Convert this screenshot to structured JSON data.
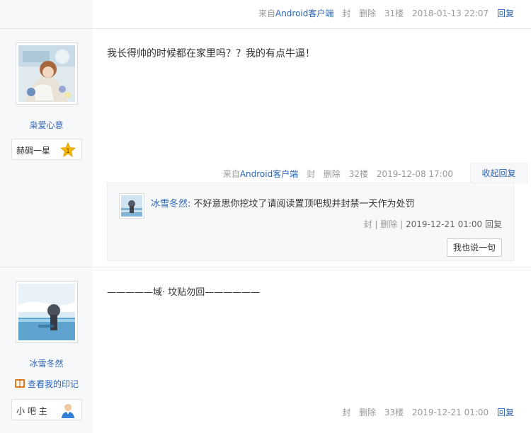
{
  "post_top": {
    "source_prefix": "来自",
    "source_client": "Android客户端",
    "ban": "封",
    "delete": "删除",
    "floor": "31楼",
    "time": "2018-01-13 22:07",
    "reply": "回复"
  },
  "post_1": {
    "username": "枭爱心意",
    "badge": {
      "text": "赫碉一星",
      "level": "1"
    },
    "text": "我长得帅的时候都在家里吗？？我的有点牛逼！",
    "meta": {
      "source_prefix": "来自",
      "source_client": "Android客户端",
      "ban": "封",
      "delete": "删除",
      "floor": "32楼",
      "time": "2019-12-08 17:00"
    },
    "collapse_reply": "收起回复",
    "sub_reply": {
      "user": "冰雪冬然:",
      "text": "不好意思你挖坟了请阅读置顶吧规并封禁一天作为处罚",
      "ban": "封",
      "sep": "|",
      "delete": "删除",
      "time": "2019-12-21 01:00",
      "reply": "回复"
    },
    "say_button": "我也说一句"
  },
  "post_2": {
    "username": "冰雪冬然",
    "mark_link": "查看我的印记",
    "badge": {
      "text": "小 吧 主"
    },
    "text": "—————域· 坟贴勿回——————",
    "meta": {
      "ban": "封",
      "delete": "删除",
      "floor": "33楼",
      "time": "2019-12-21 01:00",
      "reply": "回复"
    }
  },
  "colors": {
    "link": "#2d64b3",
    "sidebar_bg": "#f7f8fa",
    "meta_gray": "#999999",
    "star_gold": "#f5b800"
  },
  "icons": {
    "level_badge": "star-level-icon",
    "moderator": "moderator-person-icon",
    "mark": "book-mark-icon"
  }
}
